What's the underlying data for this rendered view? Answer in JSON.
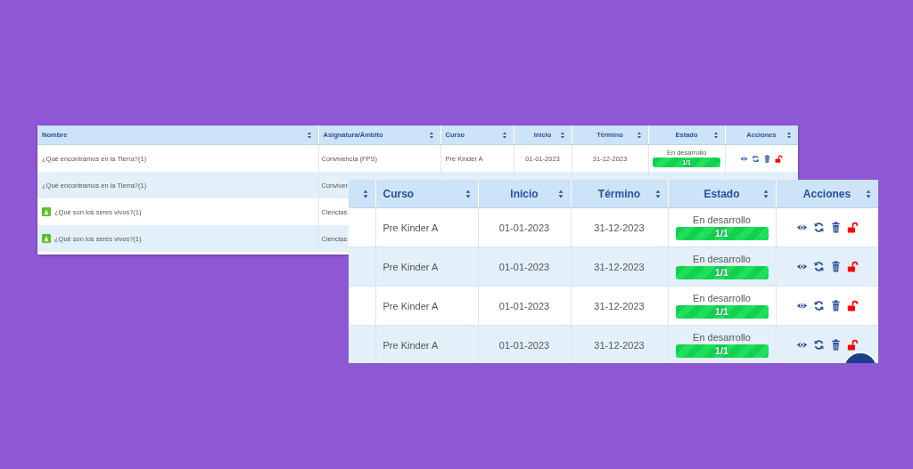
{
  "back_table": {
    "columns": [
      "Nombre",
      "Asignatura/Ámbito",
      "Curso",
      "Inicio",
      "Término",
      "Estado",
      "Acciones"
    ],
    "rows": [
      {
        "nombre": "¿Qué encontramos en la Tierra?(1)",
        "icon": false,
        "asignatura": "Convivencia (FPS)",
        "curso": "Pre Kinder A",
        "inicio": "01-01-2023",
        "termino": "31-12-2023",
        "estado": "En desarrollo",
        "progress": {
          "label": "1/1",
          "level": 1
        },
        "actions": true
      },
      {
        "nombre": "¿Qué encontramos en la Tierra?(1)",
        "icon": false,
        "asignatura": "Conviver"
      },
      {
        "nombre": "¿Qué son los seres vivos?(1)",
        "icon": true,
        "asignatura": "Ciencias"
      },
      {
        "nombre": "¿Qué son los seres vivos?(1)",
        "icon": true,
        "asignatura": "Ciencias"
      }
    ]
  },
  "front_table": {
    "columns": [
      "Curso",
      "Inicio",
      "Término",
      "Estado",
      "Acciones"
    ],
    "rows": [
      {
        "curso": "Pre Kinder A",
        "inicio": "01-01-2023",
        "termino": "31-12-2023",
        "estado": "En desarrollo",
        "progress": {
          "label": "1/1",
          "level": 1
        }
      },
      {
        "curso": "Pre Kinder A",
        "inicio": "01-01-2023",
        "termino": "31-12-2023",
        "estado": "En desarrollo",
        "progress": {
          "label": "1/1",
          "level": 1
        }
      },
      {
        "curso": "Pre Kinder A",
        "inicio": "01-01-2023",
        "termino": "31-12-2023",
        "estado": "En desarrollo",
        "progress": {
          "label": "1/1",
          "level": 1
        }
      },
      {
        "curso": "Pre Kinder A",
        "inicio": "01-01-2023",
        "termino": "31-12-2023",
        "estado": "En desarrollo",
        "progress": {
          "label": "1/1",
          "level": 1
        }
      }
    ]
  }
}
